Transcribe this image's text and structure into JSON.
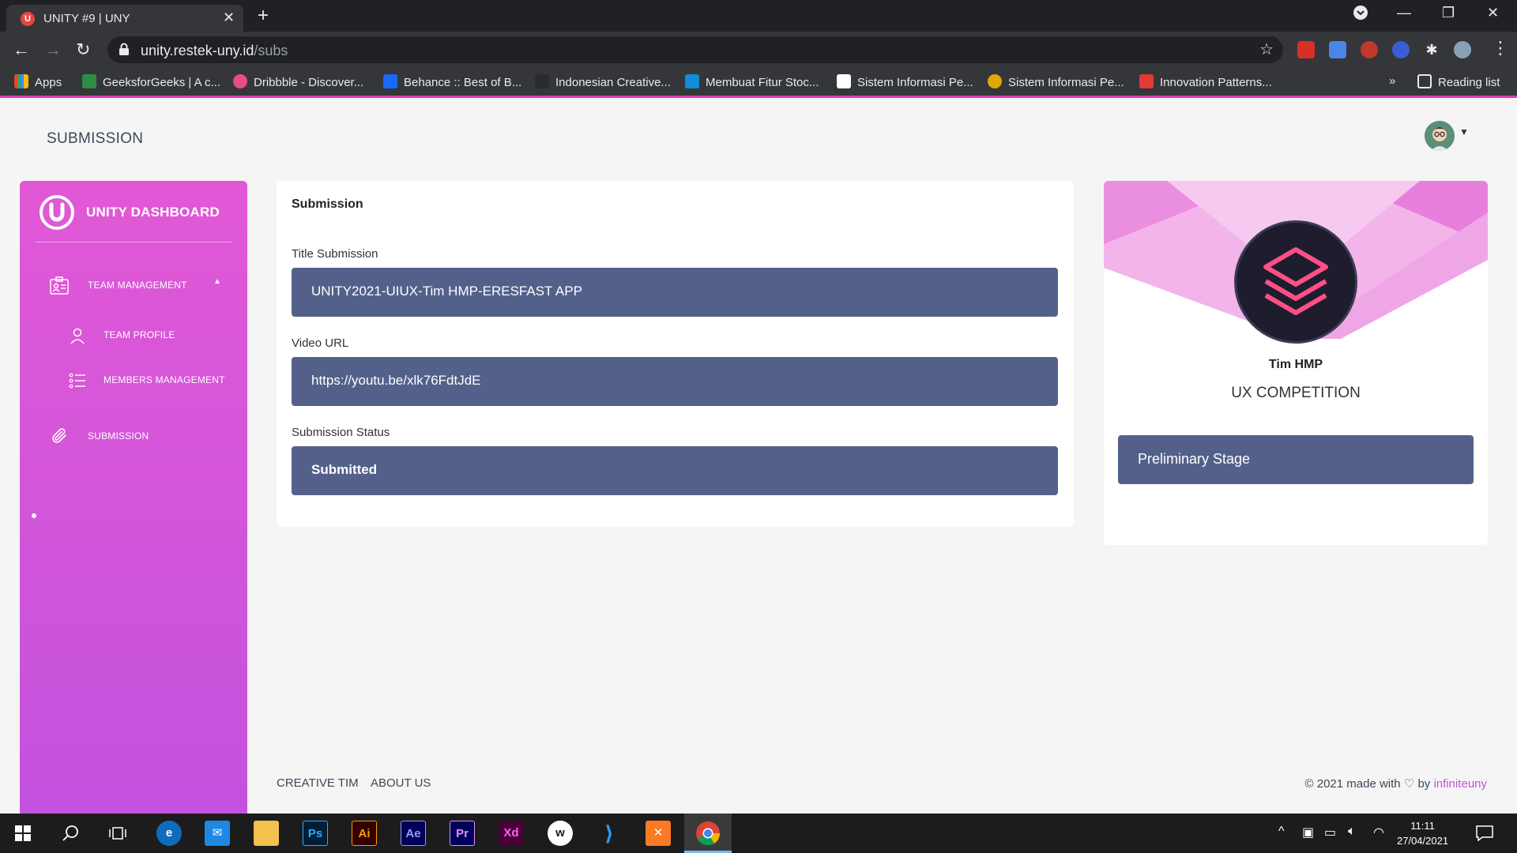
{
  "browser": {
    "tab_title": "UNITY #9 | UNY",
    "favicon_letter": "U",
    "url_host": "unity.restek-uny.id",
    "url_path": "/subs",
    "bookmarks": [
      "Apps",
      "GeeksforGeeks | A c...",
      "Dribbble - Discover...",
      "Behance :: Best of B...",
      "Indonesian Creative...",
      "Membuat Fitur Stoc...",
      "Sistem Informasi Pe...",
      "Sistem Informasi Pe...",
      "Innovation Patterns..."
    ],
    "bookmarks_overflow": "»",
    "reading_list": "Reading list"
  },
  "header": {
    "page_title": "SUBMISSION"
  },
  "sidebar": {
    "brand": "UNITY DASHBOARD",
    "items": [
      {
        "label": "TEAM MANAGEMENT"
      },
      {
        "label": "TEAM PROFILE"
      },
      {
        "label": "MEMBERS MANAGEMENT"
      },
      {
        "label": "SUBMISSION",
        "active": true
      }
    ]
  },
  "submission": {
    "card_title": "Submission",
    "title_label": "Title Submission",
    "title_value": "UNITY2021-UIUX-Tim HMP-ERESFAST APP",
    "video_label": "Video URL",
    "video_value": "https://youtu.be/xlk76FdtJdE",
    "status_label": "Submission Status",
    "status_value": "Submitted"
  },
  "profile": {
    "team_name": "Tim HMP",
    "category": "UX COMPETITION",
    "stage": "Preliminary Stage"
  },
  "footer": {
    "links": [
      "CREATIVE TIM",
      "ABOUT US"
    ],
    "made_with": "© 2021 made with",
    "by": "by",
    "brand": "infiniteuny"
  },
  "taskbar": {
    "time": "11:11",
    "date": "27/04/2021",
    "apps": [
      "Ps",
      "Ai",
      "Ae",
      "Pr",
      "Xd"
    ]
  },
  "colors": {
    "accent": "#e158d6",
    "field_bg": "#53618a",
    "brand_link": "#c452de"
  }
}
